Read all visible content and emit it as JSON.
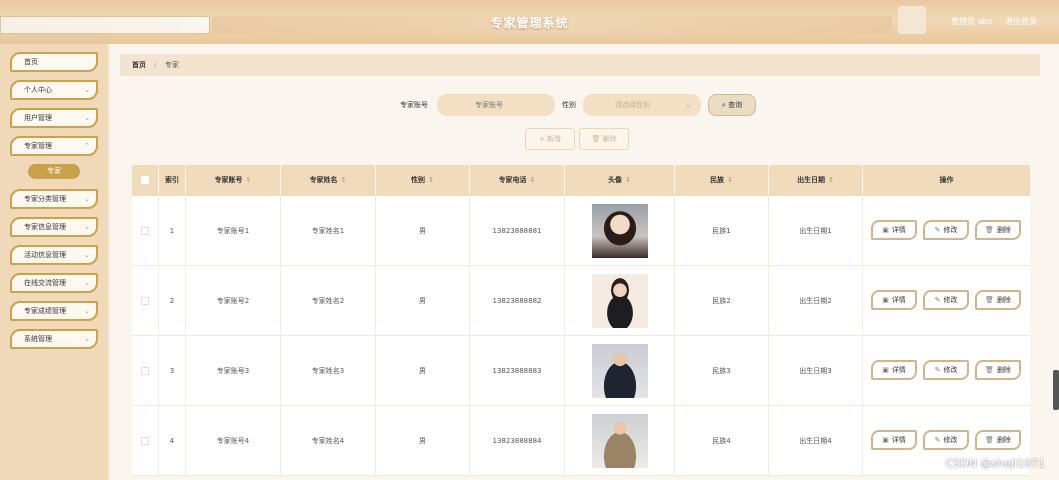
{
  "header": {
    "title": "专家管理系统",
    "user_label": "管理员 abo",
    "logout": "退出登录"
  },
  "sidebar": {
    "items": [
      {
        "label": "首页",
        "has_arrow": false
      },
      {
        "label": "个人中心",
        "has_arrow": true
      },
      {
        "label": "用户管理",
        "has_arrow": true
      },
      {
        "label": "专家管理",
        "has_arrow": true
      },
      {
        "label": "专家分类管理",
        "has_arrow": true
      },
      {
        "label": "专家信息管理",
        "has_arrow": true
      },
      {
        "label": "活动信息管理",
        "has_arrow": true
      },
      {
        "label": "在线交流管理",
        "has_arrow": true
      },
      {
        "label": "专家成绩管理",
        "has_arrow": true
      },
      {
        "label": "系统管理",
        "has_arrow": true
      }
    ],
    "active_sub": "专家"
  },
  "breadcrumb": {
    "home": "首页",
    "current": "专家"
  },
  "search": {
    "account_label": "专家账号",
    "account_placeholder": "专家账号",
    "gender_label": "性别",
    "gender_placeholder": "请选择性别",
    "search_button": "查询"
  },
  "actions": {
    "add": "新增",
    "delete": "删除"
  },
  "table": {
    "headers": {
      "index": "索引",
      "account": "专家账号",
      "name": "专家姓名",
      "gender": "性别",
      "phone": "专家电话",
      "avatar": "头像",
      "ethnicity": "民族",
      "birth": "出生日期",
      "ops": "操作"
    },
    "op_labels": {
      "detail": "详情",
      "edit": "修改",
      "delete": "删除"
    },
    "rows": [
      {
        "index": "1",
        "account": "专家账号1",
        "name": "专家姓名1",
        "gender": "男",
        "phone": "13823888881",
        "ethnicity": "民族1",
        "birth": "出生日期1"
      },
      {
        "index": "2",
        "account": "专家账号2",
        "name": "专家姓名2",
        "gender": "男",
        "phone": "13823888882",
        "ethnicity": "民族2",
        "birth": "出生日期2"
      },
      {
        "index": "3",
        "account": "专家账号3",
        "name": "专家姓名3",
        "gender": "男",
        "phone": "13823888883",
        "ethnicity": "民族3",
        "birth": "出生日期3"
      },
      {
        "index": "4",
        "account": "专家账号4",
        "name": "专家姓名4",
        "gender": "男",
        "phone": "13823888884",
        "ethnicity": "民族4",
        "birth": "出生日期4"
      }
    ]
  },
  "watermark": "CSDN @sheji1071",
  "colors": {
    "accent": "#c9a14a",
    "header_bg": "#e9c9a0",
    "sidebar_bg": "#efd9b8",
    "table_head": "#f0dcbd"
  }
}
